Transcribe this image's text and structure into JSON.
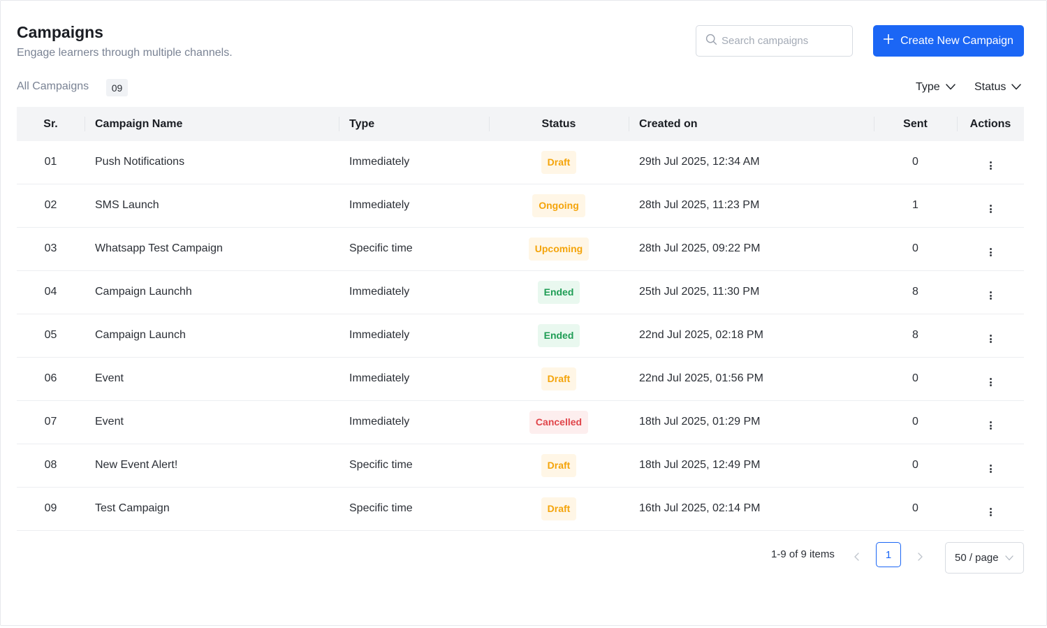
{
  "header": {
    "title": "Campaigns",
    "subtitle": "Engage learners through multiple channels."
  },
  "search": {
    "placeholder": "Search campaigns",
    "value": ""
  },
  "create_button": {
    "label": "Create New Campaign",
    "icon": "plus-icon"
  },
  "tabs": {
    "all_label": "All Campaigns",
    "all_count": "09"
  },
  "filters": {
    "type_label": "Type",
    "status_label": "Status"
  },
  "table": {
    "columns": {
      "sr": "Sr.",
      "name": "Campaign Name",
      "type": "Type",
      "status": "Status",
      "created": "Created on",
      "sent": "Sent",
      "actions": "Actions"
    },
    "rows": [
      {
        "sr": "01",
        "name": "Push Notifications",
        "type": "Immediately",
        "status": "Draft",
        "status_kind": "warning",
        "created": "29th Jul 2025, 12:34 AM",
        "sent": "0"
      },
      {
        "sr": "02",
        "name": "SMS Launch",
        "type": "Immediately",
        "status": "Ongoing",
        "status_kind": "warning",
        "created": "28th Jul 2025, 11:23 PM",
        "sent": "1"
      },
      {
        "sr": "03",
        "name": "Whatsapp Test Campaign",
        "type": "Specific time",
        "status": "Upcoming",
        "status_kind": "warning",
        "created": "28th Jul 2025, 09:22 PM",
        "sent": "0"
      },
      {
        "sr": "04",
        "name": "Campaign Launchh",
        "type": "Immediately",
        "status": "Ended",
        "status_kind": "success",
        "created": "25th Jul 2025, 11:30 PM",
        "sent": "8"
      },
      {
        "sr": "05",
        "name": "Campaign Launch",
        "type": "Immediately",
        "status": "Ended",
        "status_kind": "success",
        "created": "22nd Jul 2025, 02:18 PM",
        "sent": "8"
      },
      {
        "sr": "06",
        "name": "Event",
        "type": "Immediately",
        "status": "Draft",
        "status_kind": "warning",
        "created": "22nd Jul 2025, 01:56 PM",
        "sent": "0"
      },
      {
        "sr": "07",
        "name": "Event",
        "type": "Immediately",
        "status": "Cancelled",
        "status_kind": "danger",
        "created": "18th Jul 2025, 01:29 PM",
        "sent": "0"
      },
      {
        "sr": "08",
        "name": "New Event Alert!",
        "type": "Specific time",
        "status": "Draft",
        "status_kind": "warning",
        "created": "18th Jul 2025, 12:49 PM",
        "sent": "0"
      },
      {
        "sr": "09",
        "name": "Test Campaign",
        "type": "Specific time",
        "status": "Draft",
        "status_kind": "warning",
        "created": "16th Jul 2025, 02:14 PM",
        "sent": "0"
      }
    ]
  },
  "pagination": {
    "range_text": "1-9 of 9 items",
    "current_page": "1",
    "page_size": "50 / page"
  },
  "colors": {
    "accent": "#1b66f5",
    "warning_text": "#f4a40b",
    "warning_bg": "#fff6e6",
    "success_text": "#1f9d55",
    "success_bg": "#e9f8ef",
    "danger_text": "#e0454a",
    "danger_bg": "#fdeeee"
  }
}
